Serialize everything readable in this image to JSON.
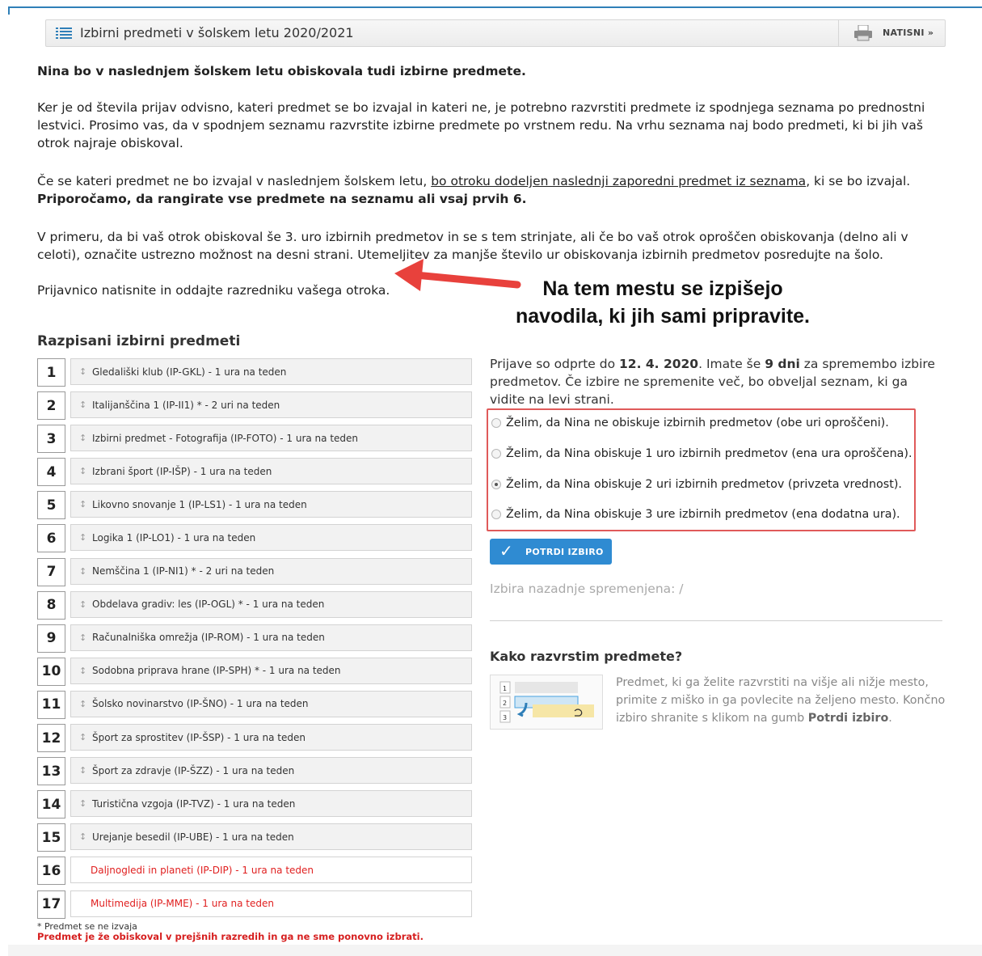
{
  "header": {
    "title": "Izbirni predmeti v šolskem letu 2020/2021",
    "print_label": "NATISNI »"
  },
  "intro": {
    "heading": "Nina bo v naslednjem šolskem letu obiskovala tudi izbirne predmete.",
    "p1": "Ker je od števila prijav odvisno, kateri predmet se bo izvajal in kateri ne, je potrebno razvrstiti predmete iz spodnjega seznama po prednostni lestvici. Prosimo vas, da v spodnjem seznamu razvrstite izbirne predmete po vrstnem redu. Na vrhu seznama naj bodo predmeti, ki bi jih vaš otrok najraje obiskoval.",
    "p2_a": "Če se kateri predmet ne bo izvajal v naslednjem šolskem letu, ",
    "p2_link": "bo otroku dodeljen naslednji zaporedni predmet iz seznama",
    "p2_b": ", ki se bo izvajal.",
    "p2_bold": "Priporočamo, da rangirate vse predmete na seznamu ali vsaj prvih 6.",
    "p3": "V primeru, da bi vaš otrok obiskoval še 3. uro izbirnih predmetov in se s tem strinjate, ali če bo vaš otrok oproščen obiskovanja (delno ali v celoti), označite ustrezno možnost na desni strani. Utemeljitev za manjše število ur obiskovanja izbirnih predmetov posredujte na šolo.",
    "p4": "Prijavnico natisnite in oddajte razredniku vašega otroka."
  },
  "annotation": {
    "line1": "Na tem mestu se izpišejo",
    "line2": "navodila, ki jih sami pripravite.",
    "color": "#e8413c"
  },
  "list": {
    "title": "Razpisani izbirni predmeti",
    "items": [
      {
        "rank": "1",
        "label": "Gledališki klub (IP-GKL) - 1 ura na teden",
        "disabled": false
      },
      {
        "rank": "2",
        "label": "Italijanščina 1 (IP-II1) * - 2 uri na teden",
        "disabled": false
      },
      {
        "rank": "3",
        "label": "Izbirni predmet - Fotografija (IP-FOTO) - 1 ura na teden",
        "disabled": false
      },
      {
        "rank": "4",
        "label": "Izbrani šport (IP-IŠP) - 1 ura na teden",
        "disabled": false
      },
      {
        "rank": "5",
        "label": "Likovno snovanje 1 (IP-LS1) - 1 ura na teden",
        "disabled": false
      },
      {
        "rank": "6",
        "label": "Logika 1 (IP-LO1) - 1 ura na teden",
        "disabled": false
      },
      {
        "rank": "7",
        "label": "Nemščina 1 (IP-NI1) * - 2 uri na teden",
        "disabled": false
      },
      {
        "rank": "8",
        "label": "Obdelava gradiv: les (IP-OGL) * - 1 ura na teden",
        "disabled": false
      },
      {
        "rank": "9",
        "label": "Računalniška omrežja (IP-ROM) - 1 ura na teden",
        "disabled": false
      },
      {
        "rank": "10",
        "label": "Sodobna priprava hrane (IP-SPH) * - 1 ura na teden",
        "disabled": false
      },
      {
        "rank": "11",
        "label": "Šolsko novinarstvo (IP-ŠNO) - 1 ura na teden",
        "disabled": false
      },
      {
        "rank": "12",
        "label": "Šport za sprostitev (IP-ŠSP) - 1 ura na teden",
        "disabled": false
      },
      {
        "rank": "13",
        "label": "Šport za zdravje (IP-ŠZZ) - 1 ura na teden",
        "disabled": false
      },
      {
        "rank": "14",
        "label": "Turistična vzgoja (IP-TVZ) - 1 ura na teden",
        "disabled": false
      },
      {
        "rank": "15",
        "label": "Urejanje besedil (IP-UBE) - 1 ura na teden",
        "disabled": false
      },
      {
        "rank": "16",
        "label": "Daljnogledi in planeti (IP-DIP) - 1 ura na teden",
        "disabled": true
      },
      {
        "rank": "17",
        "label": "Multimedija (IP-MME) - 1 ura na teden",
        "disabled": true
      }
    ],
    "note1": "* Predmet se ne izvaja",
    "note2": "Predmet je že obiskoval v prejšnih razredih in ga ne sme ponovno izbrati."
  },
  "right": {
    "info_a": "Prijave so odprte do ",
    "deadline": "12. 4. 2020",
    "info_b": ". Imate še ",
    "days_left": "9 dni",
    "info_c": " za spremembo izbire predmetov. Če izbire ne spremenite več, bo obveljal seznam, ki ga vidite na levi strani.",
    "options": [
      {
        "label": "Želim, da Nina ne obiskuje izbirnih predmetov (obe uri oproščeni).",
        "checked": false
      },
      {
        "label": "Želim, da Nina obiskuje 1 uro izbirnih predmetov (ena ura oproščena).",
        "checked": false
      },
      {
        "label": "Želim, da Nina obiskuje 2 uri izbirnih predmetov (privzeta vrednost).",
        "checked": true
      },
      {
        "label": "Želim, da Nina obiskuje 3 ure izbirnih predmetov (ena dodatna ura).",
        "checked": false
      }
    ],
    "confirm_label": "POTRDI IZBIRO",
    "last_changed": "Izbira nazadnje spremenjena: /",
    "howto_title": "Kako razvrstim predmete?",
    "howto_text_a": "Predmet, ki ga želite razvrstiti na višje ali nižje mesto, primite z miško in ga povlecite na željeno mesto. Končno izbiro shranite s klikom na gumb ",
    "howto_text_bold": "Potrdi izbiro",
    "howto_text_b": ".",
    "howto_img_ranks": [
      "1",
      "2",
      "3"
    ]
  }
}
